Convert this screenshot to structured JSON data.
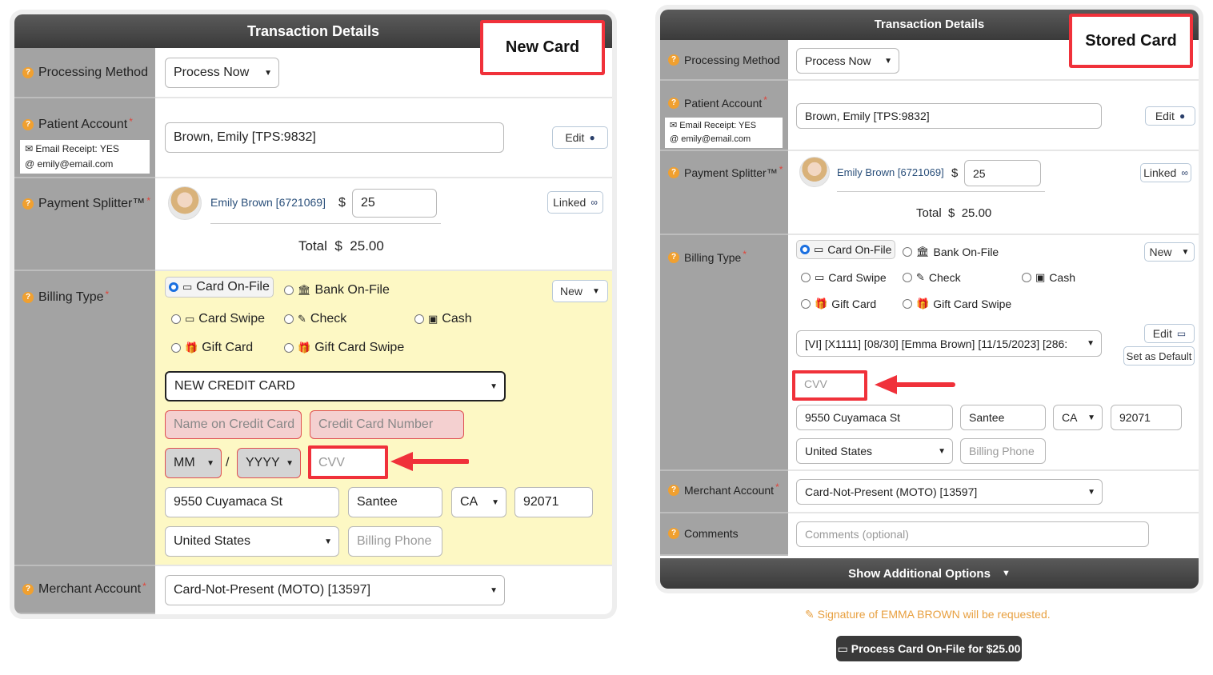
{
  "left": {
    "header_title": "Transaction Details",
    "callout": "New Card",
    "processing_method": {
      "label": "Processing Method",
      "value": "Process Now"
    },
    "patient_account": {
      "label": "Patient Account",
      "email_receipt": "Email Receipt: YES",
      "email": "emily@email.com",
      "value": "Brown, Emily [TPS:9832]",
      "edit_label": "Edit"
    },
    "payment_splitter": {
      "label": "Payment Splitter™",
      "name": "Emily Brown [6721069]",
      "currency": "$",
      "amount": "25",
      "linked_label": "Linked",
      "total_label": "Total",
      "total_currency": "$",
      "total_value": "25.00"
    },
    "billing_type": {
      "label": "Billing Type",
      "new_label": "New",
      "options": {
        "card_on_file": "Card On-File",
        "bank_on_file": "Bank On-File",
        "card_swipe": "Card Swipe",
        "check": "Check",
        "cash": "Cash",
        "gift_card": "Gift Card",
        "gift_card_swipe": "Gift Card Swipe"
      },
      "card_select": "NEW CREDIT CARD",
      "name_placeholder": "Name on Credit Card",
      "number_placeholder": "Credit Card Number",
      "month": "MM",
      "slash": "/",
      "year": "YYYY",
      "cvv_placeholder": "CVV",
      "street": "9550 Cuyamaca St",
      "city": "Santee",
      "state": "CA",
      "zip": "92071",
      "country": "United States",
      "phone_placeholder": "Billing Phone"
    },
    "merchant_account": {
      "label": "Merchant Account",
      "value": "Card-Not-Present (MOTO) [13597]"
    }
  },
  "right": {
    "header_title": "Transaction Details",
    "callout": "Stored Card",
    "processing_method": {
      "label": "Processing Method",
      "value": "Process Now"
    },
    "patient_account": {
      "label": "Patient Account",
      "email_receipt": "Email Receipt: YES",
      "email": "emily@email.com",
      "value": "Brown, Emily [TPS:9832]",
      "edit_label": "Edit"
    },
    "payment_splitter": {
      "label": "Payment Splitter™",
      "name": "Emily Brown [6721069]",
      "currency": "$",
      "amount": "25",
      "linked_label": "Linked",
      "total_label": "Total",
      "total_currency": "$",
      "total_value": "25.00"
    },
    "billing_type": {
      "label": "Billing Type",
      "new_label": "New",
      "options": {
        "card_on_file": "Card On-File",
        "bank_on_file": "Bank On-File",
        "card_swipe": "Card Swipe",
        "check": "Check",
        "cash": "Cash",
        "gift_card": "Gift Card",
        "gift_card_swipe": "Gift Card Swipe"
      },
      "stored_card": "[VI] [X1111] [08/30] [Emma Brown] [11/15/2023] [286:",
      "edit_label": "Edit",
      "set_default_label": "Set as Default",
      "cvv_placeholder": "CVV",
      "street": "9550 Cuyamaca St",
      "city": "Santee",
      "state": "CA",
      "zip": "92071",
      "country": "United States",
      "phone_placeholder": "Billing Phone"
    },
    "merchant_account": {
      "label": "Merchant Account",
      "value": "Card-Not-Present (MOTO) [13597]"
    },
    "comments": {
      "label": "Comments",
      "placeholder": "Comments (optional)"
    },
    "show_options": "Show Additional Options"
  },
  "signature_note": "Signature of EMMA BROWN will be requested.",
  "process_button": "Process Card On-File for $25.00",
  "colors": {
    "highlight": "#f0313a",
    "yellow_bg": "#fdf8c4",
    "label_bg": "#a3a3a3",
    "header_bg": "#3a3a3a",
    "signature": "#e8a040"
  }
}
